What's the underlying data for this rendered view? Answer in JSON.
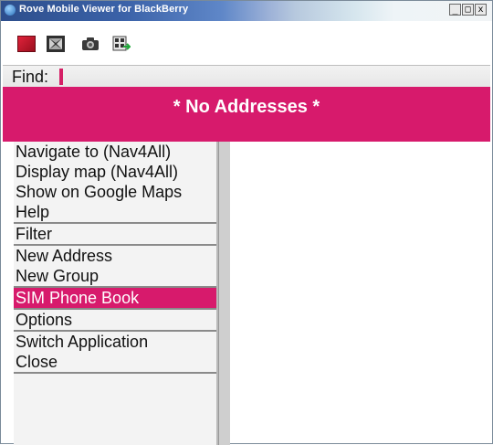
{
  "window": {
    "title": "Rove Mobile Viewer for BlackBerry",
    "controls": [
      "_",
      "□",
      "x"
    ]
  },
  "toolbar": {
    "icons": [
      "stop-icon",
      "fullscreen-icon",
      "camera-icon",
      "export-icon"
    ]
  },
  "find": {
    "label": "Find:"
  },
  "banner": {
    "text": "* No Addresses *"
  },
  "menu": {
    "groups": [
      [
        "Navigate to (Nav4All)",
        "Display map (Nav4All)",
        "Show on Google Maps",
        "Help"
      ],
      [
        "Filter"
      ],
      [
        "New Address",
        "New Group"
      ],
      [
        "SIM Phone Book"
      ],
      [
        "Options"
      ],
      [
        "Switch Application",
        "Close"
      ]
    ],
    "selected": "SIM Phone Book"
  },
  "colors": {
    "accent": "#d71a6c",
    "title_bar": "#2d4e8c"
  }
}
